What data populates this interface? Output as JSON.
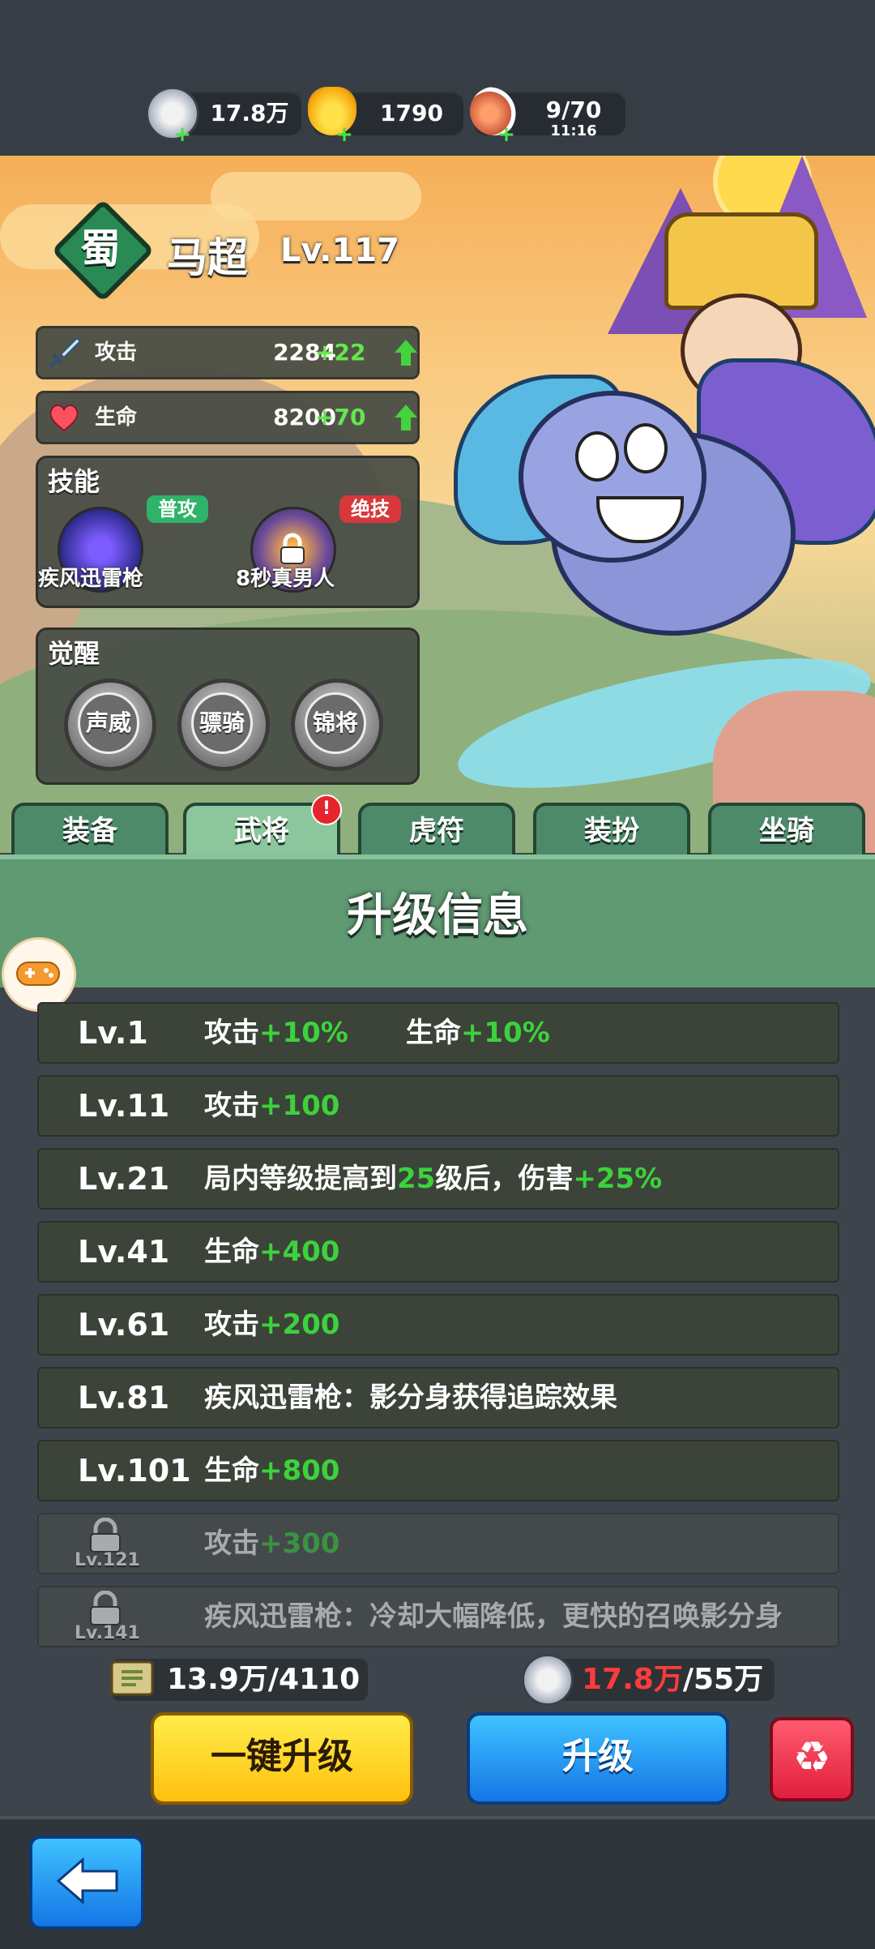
{
  "resources": [
    {
      "icon": "coin-icon",
      "value": "17.8万"
    },
    {
      "icon": "gold-ingot-icon",
      "value": "1790"
    },
    {
      "icon": "meat-stamina-icon",
      "value": "9/70",
      "timer": "11:16"
    }
  ],
  "hero": {
    "faction": "蜀",
    "name": "马超",
    "level": "Lv.117",
    "stats": [
      {
        "icon": "sword-icon",
        "label": "攻击",
        "value": "2284",
        "bonus": "+22"
      },
      {
        "icon": "heart-icon",
        "label": "生命",
        "value": "8200",
        "bonus": "+70"
      }
    ]
  },
  "skills": {
    "title": "技能",
    "items": [
      {
        "badge": "普攻",
        "name": "疾风迅雷枪",
        "badge_color": "#2fb36a"
      },
      {
        "badge": "绝技",
        "name": "8秒真男人",
        "badge_color": "#d7383b"
      }
    ]
  },
  "awaken": {
    "title": "觉醒",
    "items": [
      "声威",
      "骠骑",
      "锦将"
    ]
  },
  "tabs": [
    "装备",
    "武将",
    "虎符",
    "装扮",
    "坐骑"
  ],
  "active_tab": "武将",
  "notification": "!",
  "upgrade_info": {
    "title": "升级信息",
    "rows": [
      {
        "lv": "Lv.1",
        "parts": [
          [
            "攻击",
            "w"
          ],
          [
            "+10%",
            "g"
          ],
          [
            "      生命",
            "w"
          ],
          [
            "+10%",
            "g"
          ]
        ]
      },
      {
        "lv": "Lv.11",
        "parts": [
          [
            "攻击",
            "w"
          ],
          [
            "+100",
            "g"
          ]
        ]
      },
      {
        "lv": "Lv.21",
        "parts": [
          [
            "局内等级提高到",
            "w"
          ],
          [
            "25",
            "g"
          ],
          [
            "级后，伤害",
            "w"
          ],
          [
            "+25%",
            "g"
          ]
        ]
      },
      {
        "lv": "Lv.41",
        "parts": [
          [
            "生命",
            "w"
          ],
          [
            "+400",
            "g"
          ]
        ]
      },
      {
        "lv": "Lv.61",
        "parts": [
          [
            "攻击",
            "w"
          ],
          [
            "+200",
            "g"
          ]
        ]
      },
      {
        "lv": "Lv.81",
        "parts": [
          [
            "疾风迅雷枪：影分身获得追踪效果",
            "w"
          ]
        ]
      },
      {
        "lv": "Lv.101",
        "parts": [
          [
            "生命",
            "w"
          ],
          [
            "+800",
            "g"
          ]
        ]
      },
      {
        "lv": "Lv.121",
        "locked": true,
        "parts": [
          [
            "攻击",
            "w"
          ],
          [
            "+300",
            "g"
          ]
        ]
      },
      {
        "lv": "Lv.141",
        "locked": true,
        "parts": [
          [
            "疾风迅雷枪：冷却大幅降低，更快的召唤影分身",
            "w"
          ]
        ]
      }
    ]
  },
  "cost": {
    "scroll": "13.9万/4110",
    "coin_have": "17.8万",
    "coin_need": "/55万",
    "coin_have_color": "#ff3b3b"
  },
  "buttons": {
    "one_click": "一键升级",
    "upgrade": "升级",
    "recycle": "♻"
  },
  "back_label": "back-arrow-icon"
}
